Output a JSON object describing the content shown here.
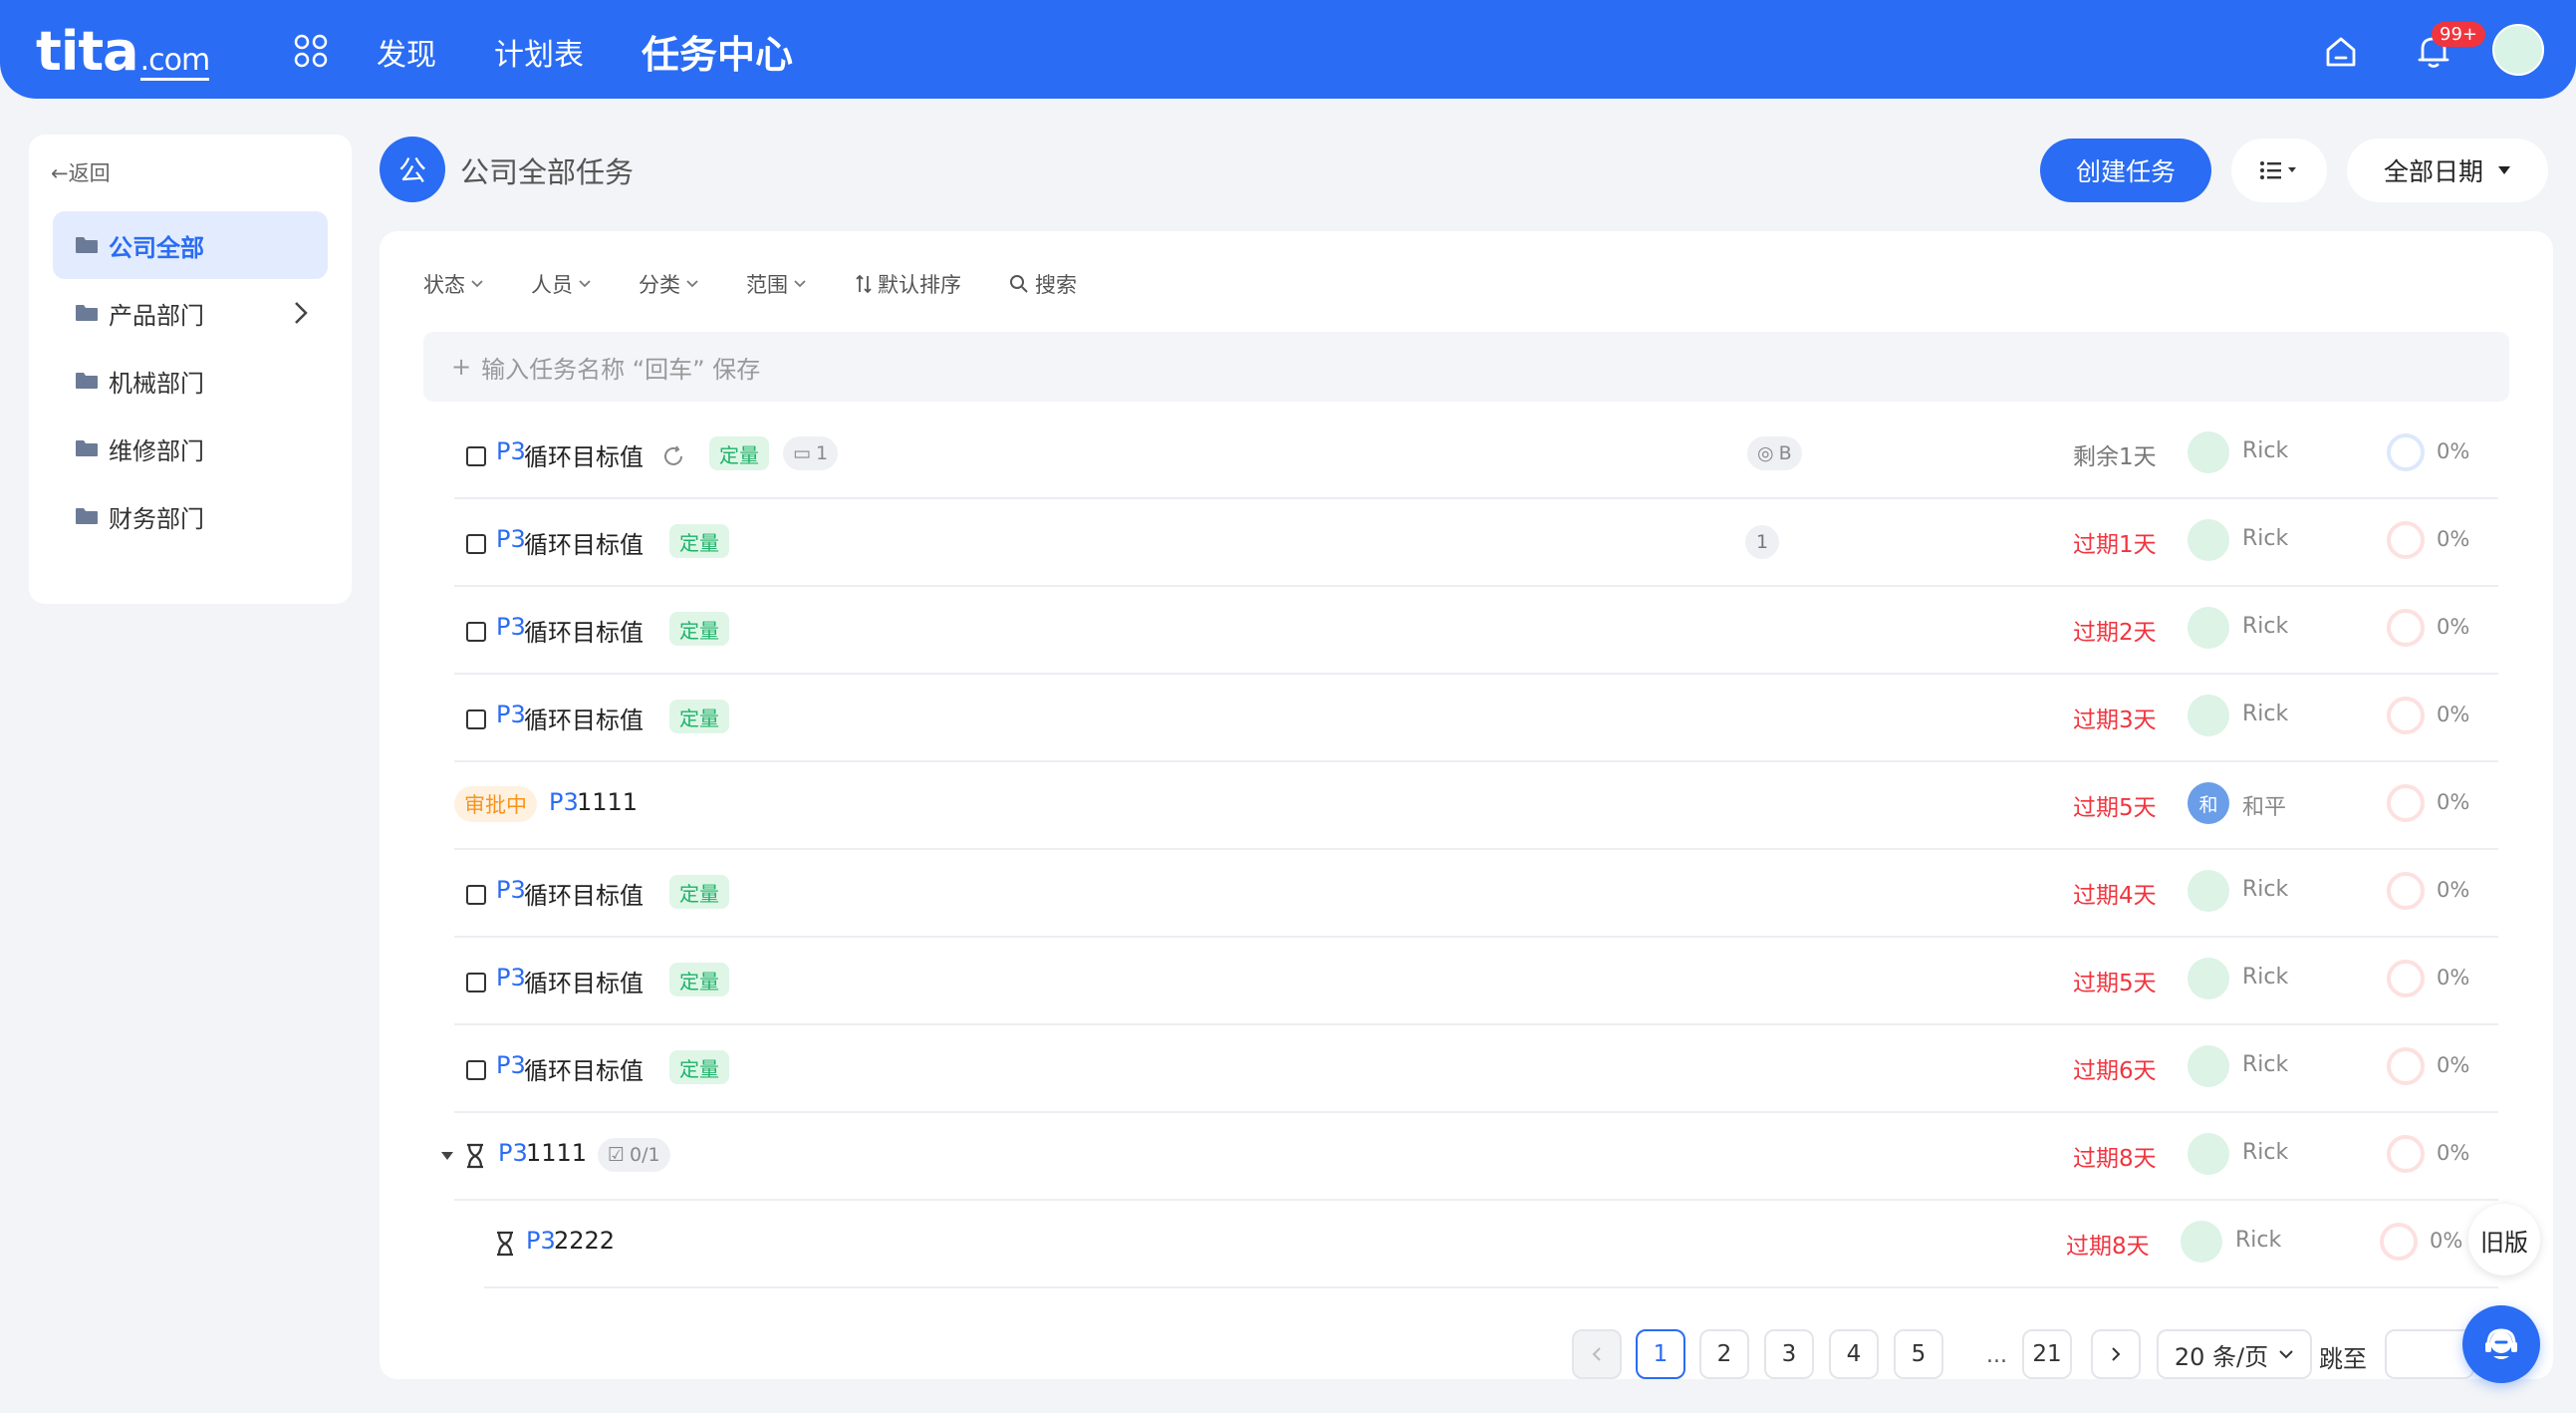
{
  "brand": {
    "logo_main": "tita",
    "logo_suffix": ".com"
  },
  "nav": {
    "items": [
      "发现",
      "计划表",
      "任务中心"
    ]
  },
  "header": {
    "notification_count": "99+"
  },
  "sidebar": {
    "back_label": "返回",
    "items": [
      "公司全部",
      "产品部门",
      "机械部门",
      "维修部门",
      "财务部门"
    ]
  },
  "page": {
    "org_avatar": "公",
    "title": "公司全部任务",
    "create_label": "创建任务",
    "date_filter": "全部日期"
  },
  "filters": {
    "status": "状态",
    "people": "人员",
    "category": "分类",
    "range": "范围",
    "sort": "默认排序",
    "search": "搜索"
  },
  "add_task": {
    "placeholder": "输入任务名称 “回车” 保存"
  },
  "tasks": [
    {
      "priority": "P3",
      "name": "循环目标值",
      "tag": "定量",
      "chip": "1",
      "goal": "B",
      "due": "剩余1天",
      "assignee": "Rick",
      "progress": "0%"
    },
    {
      "priority": "P3",
      "name": "循环目标值",
      "tag": "定量",
      "count": "1",
      "due": "过期1天",
      "assignee": "Rick",
      "progress": "0%"
    },
    {
      "priority": "P3",
      "name": "循环目标值",
      "tag": "定量",
      "due": "过期2天",
      "assignee": "Rick",
      "progress": "0%"
    },
    {
      "priority": "P3",
      "name": "循环目标值",
      "tag": "定量",
      "due": "过期3天",
      "assignee": "Rick",
      "progress": "0%"
    },
    {
      "status": "审批中",
      "priority": "P3",
      "name": "1111",
      "due": "过期5天",
      "assignee_avatar": "和",
      "assignee": "和平",
      "progress": "0%"
    },
    {
      "priority": "P3",
      "name": "循环目标值",
      "tag": "定量",
      "due": "过期4天",
      "assignee": "Rick",
      "progress": "0%"
    },
    {
      "priority": "P3",
      "name": "循环目标值",
      "tag": "定量",
      "due": "过期5天",
      "assignee": "Rick",
      "progress": "0%"
    },
    {
      "priority": "P3",
      "name": "循环目标值",
      "tag": "定量",
      "due": "过期6天",
      "assignee": "Rick",
      "progress": "0%"
    },
    {
      "priority": "P3",
      "name": "1111",
      "subtask_chip": "0/1",
      "due": "过期8天",
      "assignee": "Rick",
      "progress": "0%"
    },
    {
      "priority": "P3",
      "name": "2222",
      "due": "过期8天",
      "assignee": "Rick",
      "progress": "0%"
    }
  ],
  "pagination": {
    "pages": [
      "1",
      "2",
      "3",
      "4",
      "5",
      "21"
    ],
    "ellipsis": "...",
    "page_size": "20 条/页",
    "jump_label": "跳至"
  },
  "float": {
    "old_version": "旧版"
  },
  "colors": {
    "primary": "#2a6cf3",
    "overdue": "#f0353f",
    "tag_green": "#1fb36a",
    "pending_orange": "#f7941d"
  }
}
